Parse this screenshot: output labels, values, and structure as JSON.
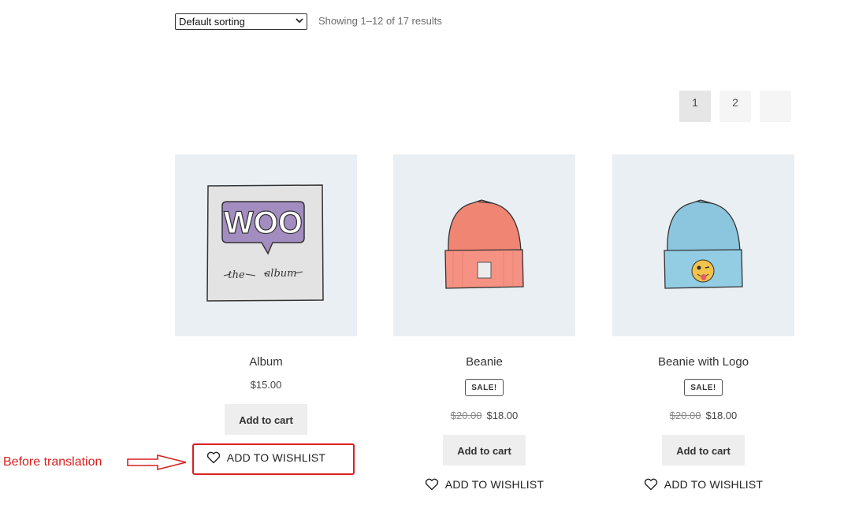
{
  "toolbar": {
    "sort_value": "Default sorting",
    "result_count": "Showing 1–12 of 17 results"
  },
  "pagination": {
    "pages": [
      "1",
      "2",
      ""
    ],
    "current": "1"
  },
  "products": [
    {
      "title": "Album",
      "price": "$15.00",
      "add_to_cart": "Add to cart",
      "wishlist": "ADD TO WISHLIST",
      "image_text": [
        "WOO",
        "the",
        "album"
      ]
    },
    {
      "title": "Beanie",
      "sale_badge": "SALE!",
      "old_price": "$20.00",
      "price": "$18.00",
      "add_to_cart": "Add to cart",
      "wishlist": "ADD TO WISHLIST"
    },
    {
      "title": "Beanie with Logo",
      "sale_badge": "SALE!",
      "old_price": "$20.00",
      "price": "$18.00",
      "add_to_cart": "Add to cart",
      "wishlist": "ADD TO WISHLIST"
    }
  ],
  "annotation": {
    "label": "Before translation",
    "color": "#d9201f"
  },
  "icons": [
    "chevron-down-icon",
    "heart-icon",
    "arrow-right-icon"
  ]
}
